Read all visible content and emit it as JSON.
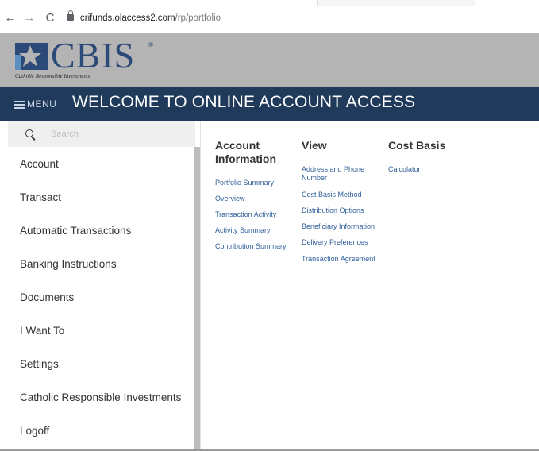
{
  "browser": {
    "url_host": "crifunds.olaccess2.com",
    "url_path": "/rp/portfolio"
  },
  "brand": {
    "wordmark": "CBIS",
    "registered": "®",
    "tagline": "Catholic Responsible Investments",
    "header_bg": "#b4b4b4",
    "wordmark_color": "#2c4a78"
  },
  "topnav": {
    "menu_label": "MENU",
    "welcome": "WELCOME TO ONLINE ACCOUNT ACCESS",
    "bg": "#1f3a5a"
  },
  "sidebar": {
    "search_placeholder": "Search",
    "items": [
      {
        "label": "Account"
      },
      {
        "label": "Transact"
      },
      {
        "label": "Automatic Transactions"
      },
      {
        "label": "Banking Instructions"
      },
      {
        "label": "Documents"
      },
      {
        "label": "I Want To"
      },
      {
        "label": "Settings"
      },
      {
        "label": "Catholic Responsible Investments"
      },
      {
        "label": "Logoff"
      }
    ]
  },
  "main": {
    "columns": [
      {
        "title_line1": "Account",
        "title_line2": "Information",
        "links": [
          "Portfolio Summary",
          "Overview",
          "Transaction Activity",
          "Activity Summary",
          "Contribution Summary"
        ]
      },
      {
        "title_line1": "View",
        "links": [
          "Address and Phone",
          "Number",
          "Cost Basis Method",
          "Distribution Options",
          "Beneficiary Information",
          "Delivery Preferences",
          "Transaction Agreement"
        ]
      },
      {
        "title_line1": "Cost Basis",
        "links": [
          "Calculator"
        ]
      }
    ],
    "link_color": "#2f5f9a"
  },
  "icons": {
    "back": "back-arrow-icon",
    "forward": "forward-arrow-icon",
    "reload": "reload-icon",
    "lock": "lock-icon",
    "menu": "hamburger-icon",
    "search": "search-icon",
    "logo_mark": "star-mark-icon"
  }
}
